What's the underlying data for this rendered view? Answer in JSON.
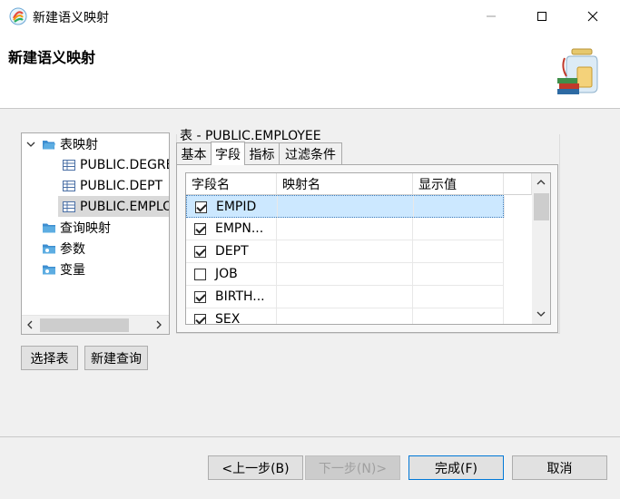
{
  "window": {
    "title": "新建语义映射"
  },
  "header": {
    "title": "新建语义映射"
  },
  "tree": {
    "root": {
      "label": "表映射"
    },
    "tables": [
      {
        "label": "PUBLIC.DEGREE"
      },
      {
        "label": "PUBLIC.DEPT"
      },
      {
        "label": "PUBLIC.EMPLOYEE"
      }
    ],
    "folders": [
      {
        "label": "查询映射"
      },
      {
        "label": "参数"
      },
      {
        "label": "变量"
      }
    ]
  },
  "table_group": {
    "title": "表 - PUBLIC.EMPLOYEE"
  },
  "tabs": [
    {
      "label": "基本"
    },
    {
      "label": "字段"
    },
    {
      "label": "指标"
    },
    {
      "label": "过滤条件"
    }
  ],
  "grid": {
    "columns": [
      "字段名",
      "映射名",
      "显示值"
    ],
    "rows": [
      {
        "checked": true,
        "field": "EMPID"
      },
      {
        "checked": true,
        "field": "EMPN..."
      },
      {
        "checked": true,
        "field": "DEPT"
      },
      {
        "checked": false,
        "field": "JOB"
      },
      {
        "checked": true,
        "field": "BIRTH..."
      },
      {
        "checked": true,
        "field": "SEX"
      }
    ]
  },
  "buttons": {
    "select_table": "选择表",
    "new_query": "新建查询",
    "prev": "<上一步(B)",
    "next": "下一步(N)>",
    "finish": "完成(F)",
    "cancel": "取消"
  },
  "colors": {
    "selection": "#cce8ff",
    "accent": "#0078d7"
  }
}
